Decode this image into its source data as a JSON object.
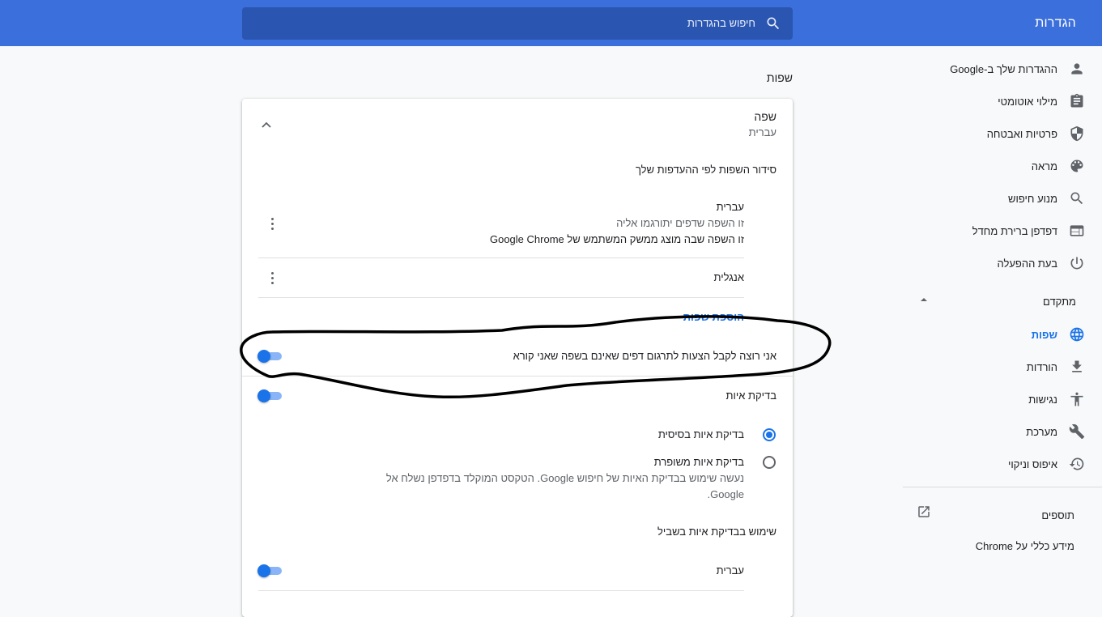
{
  "header": {
    "title": "הגדרות",
    "search_placeholder": "חיפוש בהגדרות"
  },
  "sidebar": {
    "items": [
      {
        "label": "ההגדרות שלך ב-Google",
        "icon": "person-icon"
      },
      {
        "label": "מילוי אוטומטי",
        "icon": "clipboard-icon"
      },
      {
        "label": "פרטיות ואבטחה",
        "icon": "shield-icon"
      },
      {
        "label": "מראה",
        "icon": "palette-icon"
      },
      {
        "label": "מנוע חיפוש",
        "icon": "search-icon"
      },
      {
        "label": "דפדפן ברירת מחדל",
        "icon": "browser-icon"
      },
      {
        "label": "בעת ההפעלה",
        "icon": "power-icon"
      }
    ],
    "advanced_label": "מתקדם",
    "advanced_items": [
      {
        "label": "שפות",
        "icon": "globe-icon",
        "active": true
      },
      {
        "label": "הורדות",
        "icon": "download-icon"
      },
      {
        "label": "נגישות",
        "icon": "accessibility-icon"
      },
      {
        "label": "מערכת",
        "icon": "wrench-icon"
      },
      {
        "label": "איפוס וניקוי",
        "icon": "history-icon"
      }
    ],
    "extensions_label": "תוספים",
    "about_label": "מידע כללי על Chrome"
  },
  "main": {
    "section_title": "שפות",
    "language": {
      "header_label": "שפה",
      "header_value": "עברית",
      "order_label": "סידור השפות לפי ההעדפות שלך",
      "languages": [
        {
          "name": "עברית",
          "line1": "זו השפה שדפים יתורגמו אליה",
          "line2": "זו השפה שבה מוצג ממשק המשתמש של Google Chrome"
        },
        {
          "name": "אנגלית"
        }
      ],
      "add_languages": "הוספת שפות",
      "translate_offer": "אני רוצה לקבל הצעות לתרגום דפים שאינם בשפה שאני קורא"
    },
    "spellcheck": {
      "label": "בדיקת איות",
      "basic": "בדיקת איות בסיסית",
      "enhanced": "בדיקת איות משופרת",
      "enhanced_desc_line1": "נעשה שימוש בבדיקת האיות של חיפוש Google. הטקסט המוקלד בדפדפן נשלח אל",
      "enhanced_desc_line2": "Google.",
      "use_for_label": "שימוש בבדיקת איות בשביל",
      "use_for_languages": [
        "עברית"
      ]
    },
    "toggles": {
      "translate_offer": true,
      "spellcheck": true,
      "spellcheck_hebrew": true
    },
    "selected_spellcheck": "basic"
  },
  "colors": {
    "header": "#3b6fdb",
    "search": "#2a56b1",
    "accent": "#1a73e8"
  }
}
